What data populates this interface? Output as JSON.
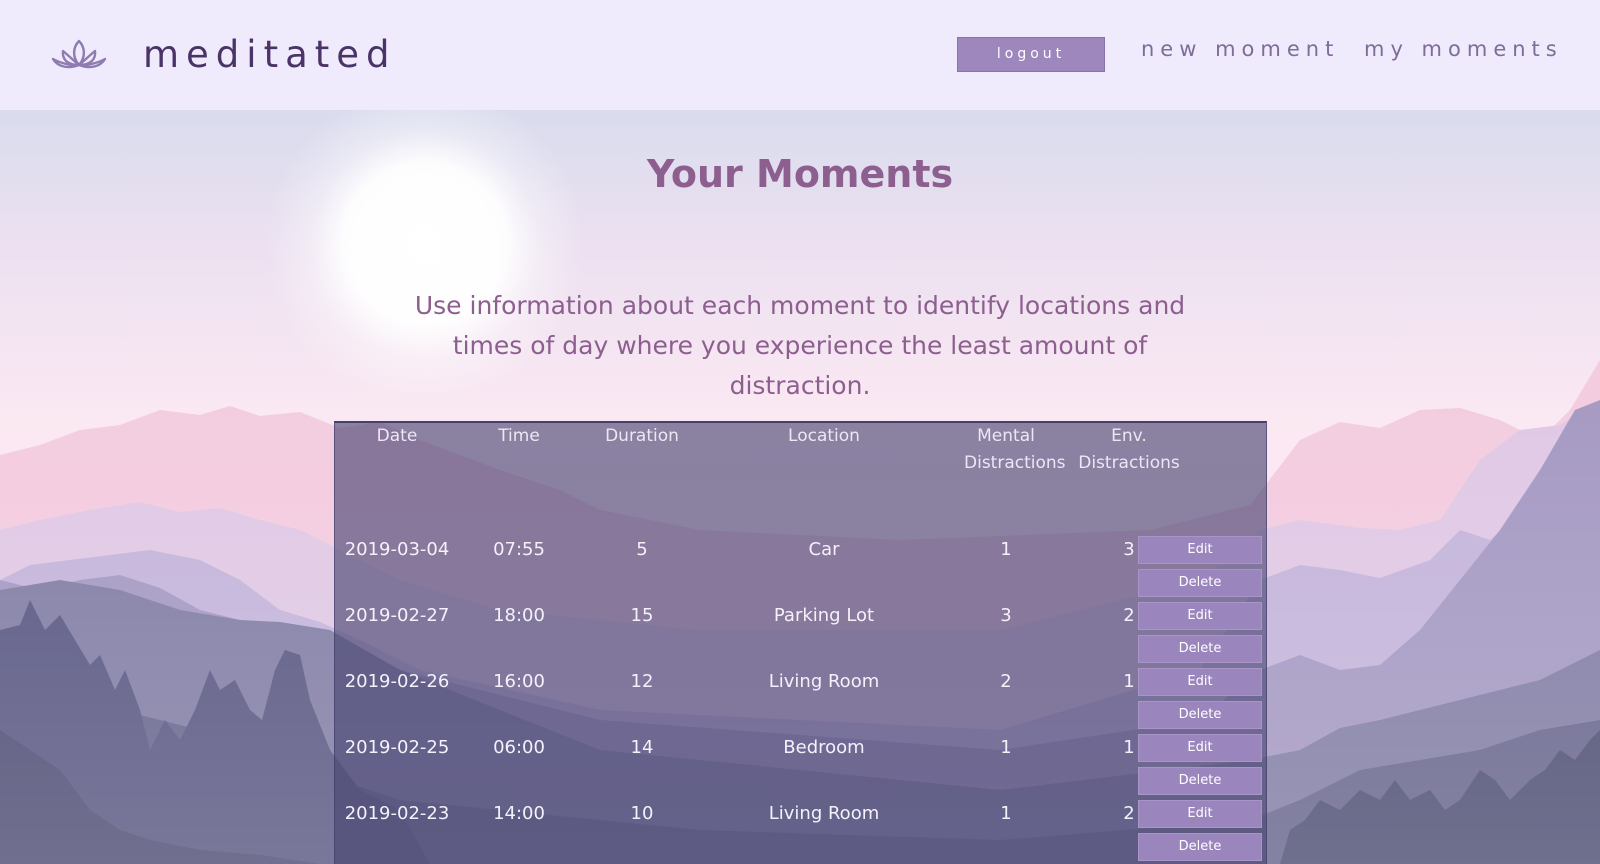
{
  "header": {
    "brand": "meditated",
    "logout_label": "logout",
    "nav": {
      "new_moment": "new moment",
      "my_moments": "my moments"
    }
  },
  "main": {
    "title": "Your Moments",
    "intro": "Use information about each moment to identify locations and times of day where you experience the least amount of distraction."
  },
  "table": {
    "headers": {
      "date": "Date",
      "time": "Time",
      "duration": "Duration",
      "location": "Location",
      "mental": "Mental Distractions",
      "env": "Env. Distractions"
    },
    "rows": [
      {
        "date": "2019-03-04",
        "time": "07:55",
        "duration": "5",
        "location": "Car",
        "mental": "1",
        "env": "3",
        "edit": "Edit",
        "delete": "Delete"
      },
      {
        "date": "2019-02-27",
        "time": "18:00",
        "duration": "15",
        "location": "Parking Lot",
        "mental": "3",
        "env": "2",
        "edit": "Edit",
        "delete": "Delete"
      },
      {
        "date": "2019-02-26",
        "time": "16:00",
        "duration": "12",
        "location": "Living Room",
        "mental": "2",
        "env": "1",
        "edit": "Edit",
        "delete": "Delete"
      },
      {
        "date": "2019-02-25",
        "time": "06:00",
        "duration": "14",
        "location": "Bedroom",
        "mental": "1",
        "env": "1",
        "edit": "Edit",
        "delete": "Delete"
      },
      {
        "date": "2019-02-23",
        "time": "14:00",
        "duration": "10",
        "location": "Living Room",
        "mental": "1",
        "env": "2",
        "edit": "Edit",
        "delete": "Delete"
      }
    ]
  },
  "icons": {
    "logo": "lotus-icon"
  },
  "colors": {
    "header_bg": "#f0eafd",
    "brand_text": "#4a3366",
    "accent_button": "#9e87bd",
    "title_text": "#8c5f8f",
    "table_overlay": "#464270"
  }
}
